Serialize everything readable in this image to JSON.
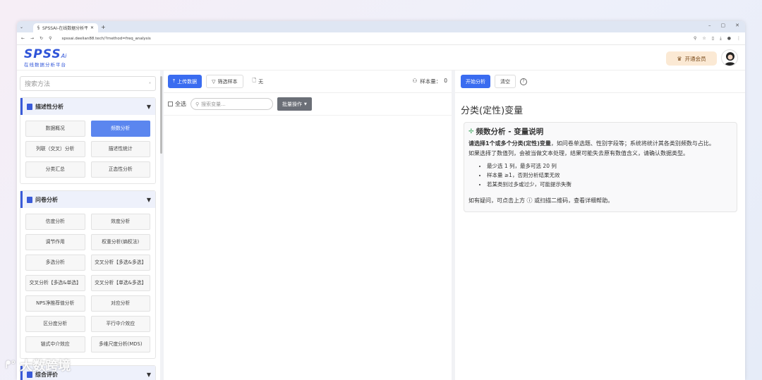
{
  "browser": {
    "tab_title": "SPSSAI-在线数据分析平台",
    "url": "spssai.deelian88.tech/?method=freq_analysis",
    "new_tab": "+"
  },
  "app": {
    "logo": "SPSS",
    "logo_ai": "Ai",
    "logo_sub": "在线数据分析平台",
    "vip_label": "开通会员"
  },
  "left": {
    "search_placeholder": "搜索方法",
    "sections": [
      {
        "title": "描述性分析",
        "items": [
          "数据概况",
          "频数分析",
          "列联（交叉）分析",
          "描述性统计",
          "分类汇总",
          "正态性分析"
        ]
      },
      {
        "title": "问卷分析",
        "items": [
          "信度分析",
          "效度分析",
          "调节作用",
          "权重分析(熵权法)",
          "多选分析",
          "交叉分析【多选&多选】",
          "交叉分析【多选&单选】",
          "交叉分析【单选&多选】",
          "NPS净推荐值分析",
          "对应分析",
          "区分度分析",
          "平行中介效应",
          "链式中介效应",
          "多维尺度分析(MDS)"
        ]
      },
      {
        "title": "综合评价",
        "items": []
      }
    ]
  },
  "mid": {
    "upload_label": "上传数据",
    "filter_label": "筛选样本",
    "file_label": "无",
    "sample_label": "样本量：",
    "sample_count": "0",
    "select_all": "全选",
    "search_placeholder": "搜索变量...",
    "batch_label": "批量操作"
  },
  "right": {
    "start_label": "开始分析",
    "clear_label": "清空",
    "help_icon": "?",
    "panel_title": "分类(定性)变量",
    "card_title": "频数分析 - 变量说明",
    "para1_bold": "请选择1个或多个分类(定性)变量",
    "para1_rest": "，如问卷单选题、性别字段等；系统将统计其各类别频数与占比。",
    "para2": "如果选择了数值列，会被当做文本处理，结果可能失去原有数值含义，请确认数据类型。",
    "bullets": [
      "最少选 1 列，最多可选 20 列",
      "样本量 ≥1，否则分析结果无效",
      "若某类别过多或过少，可能提示失衡"
    ],
    "footer": "如有疑问，可点击上方 ⓘ 或扫描二维码，查看详细帮助。"
  },
  "watermark": {
    "text": "大数跨境"
  }
}
